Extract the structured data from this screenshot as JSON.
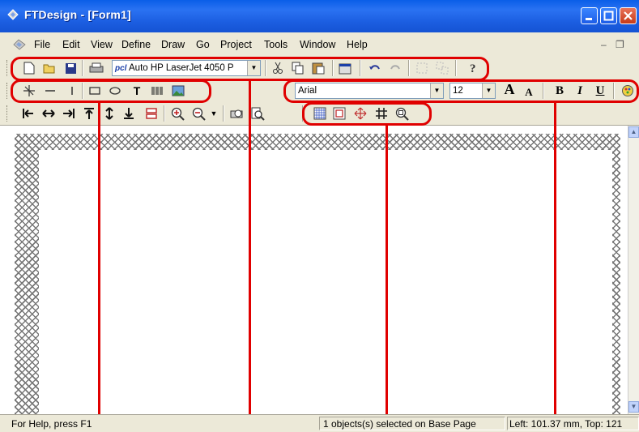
{
  "window": {
    "title": "FTDesign - [Form1]"
  },
  "menu": {
    "items": [
      {
        "label": "File"
      },
      {
        "label": "Edit"
      },
      {
        "label": "View"
      },
      {
        "label": "Define"
      },
      {
        "label": "Draw"
      },
      {
        "label": "Go"
      },
      {
        "label": "Project"
      },
      {
        "label": "Tools"
      },
      {
        "label": "Window"
      },
      {
        "label": "Help"
      }
    ],
    "mdi_minimize": "–",
    "mdi_restore": "❐"
  },
  "toolbar": {
    "printer_prefix": "pcl",
    "printer_selected": "Auto HP LaserJet 4050 P",
    "font_name": "Arial",
    "font_size": "12",
    "bold_label": "B",
    "italic_label": "I",
    "underline_label": "U",
    "grow_font_label": "A",
    "shrink_font_label": "A",
    "text_tool_label": "T"
  },
  "status": {
    "help": "For Help, press F1",
    "selection": "1 objects(s) selected on Base Page",
    "position": "Left: 101.37 mm, Top: 121"
  },
  "colors": {
    "titlebar": "#0a5ee8",
    "chrome": "#ece9d8",
    "annotation_red": "#e00000"
  }
}
